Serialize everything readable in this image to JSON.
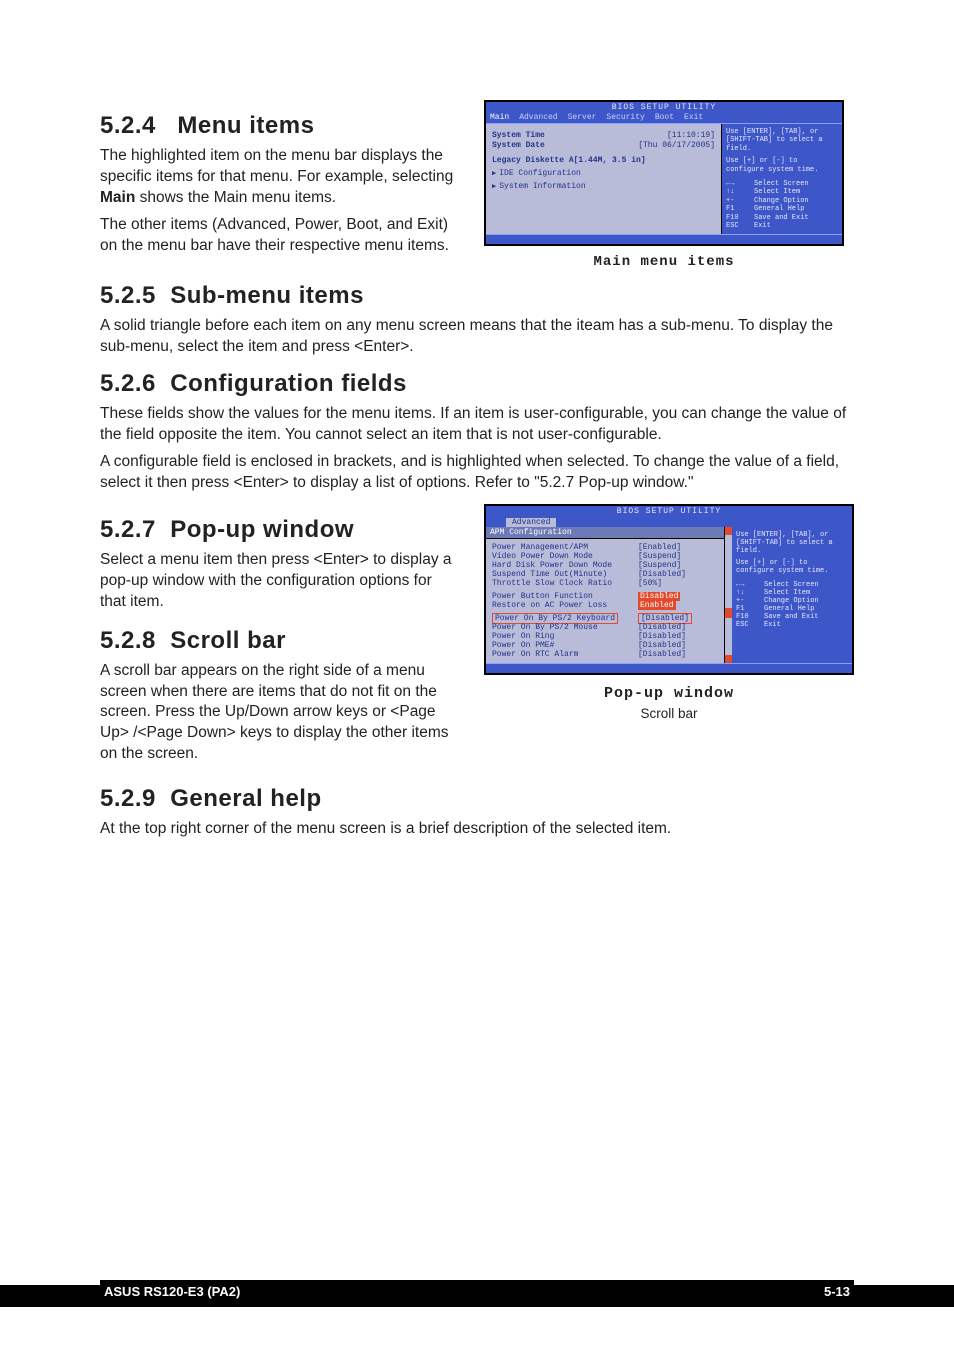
{
  "sections": {
    "s524": {
      "num": "5.2.4",
      "title": "Menu items",
      "p1": "The highlighted item on the menu bar  displays the specific items for that menu. For example, selecting ",
      "p1b": "Main",
      "p1c": " shows the Main menu items.",
      "p2": "The other items (Advanced, Power, Boot, and Exit) on the menu bar have their respective menu items."
    },
    "s525": {
      "num": "5.2.5",
      "title": "Sub-menu items",
      "p1": "A solid triangle before each item on any menu screen means that the iteam has a sub-menu. To display the sub-menu, select the item and press <Enter>."
    },
    "s526": {
      "num": "5.2.6",
      "title": "Configuration fields",
      "p1": "These fields show the values for the menu items. If an item is user-configurable, you can change the value of the field opposite the item. You cannot select an item that is not user-configurable.",
      "p2": "A configurable field is enclosed in brackets, and is highlighted when selected. To change the value of a field, select it then press <Enter> to display a list of options. Refer to \"5.2.7 Pop-up window.\""
    },
    "s527": {
      "num": "5.2.7",
      "title": "Pop-up window",
      "p1": "Select a menu item then press <Enter> to display a pop-up window with the configuration options for that item."
    },
    "s528": {
      "num": "5.2.8",
      "title": "Scroll bar",
      "p1": "A scroll bar appears on the right side of a menu screen when there are items that do not fit on the screen. Press the Up/Down arrow keys or <Page Up> /<Page Down> keys to display the other items on the screen."
    },
    "s529": {
      "num": "5.2.9",
      "title": "General help",
      "p1": "At the top right corner of the menu screen is a brief description of the selected item."
    }
  },
  "bios1": {
    "title": "BIOS SETUP UTILITY",
    "tabs": [
      "Main",
      "Advanced",
      "Server",
      "Security",
      "Boot",
      "Exit"
    ],
    "rows": {
      "time_lbl": "System Time",
      "time_val": "[11:10:19]",
      "date_lbl": "System Date",
      "date_val": "[Thu 06/17/2005]",
      "diskette": "Legacy Diskette A[1.44M, 3.5 in]",
      "ide": "IDE Configuration",
      "sysinfo": "System Information"
    },
    "help": {
      "l1": "Use [ENTER], [TAB], or [SHIFT-TAB] to select a field.",
      "l2": "Use [+] or [-] to configure system time."
    },
    "keys": [
      {
        "k": "←→",
        "d": "Select Screen"
      },
      {
        "k": "↑↓",
        "d": "Select Item"
      },
      {
        "k": "+-",
        "d": "Change Option"
      },
      {
        "k": "F1",
        "d": "General Help"
      },
      {
        "k": "F10",
        "d": "Save and Exit"
      },
      {
        "k": "ESC",
        "d": "Exit"
      }
    ],
    "caption": "Main menu items"
  },
  "bios2": {
    "title": "BIOS SETUP UTILITY",
    "tab": "Advanced",
    "header": "APM Configuration",
    "items": [
      {
        "lbl": "Power Management/APM",
        "val": "[Enabled]"
      },
      {
        "lbl": "Video Power Down Mode",
        "val": "[Suspend]"
      },
      {
        "lbl": "Hard Disk Power Down Mode",
        "val": "[Suspend]"
      },
      {
        "lbl": "Suspend Time Out(Minute)",
        "val": "[Disabled]"
      },
      {
        "lbl": "Throttle Slow Clock Ratio",
        "val": "[50%]"
      },
      {
        "lbl": "Power Button Function",
        "val": "Disabled",
        "hl": true
      },
      {
        "lbl": "Restore on AC Power Loss",
        "val": "Enabled",
        "hl": true
      },
      {
        "lbl": "Power On By PS/2 Keyboard",
        "val": "[Disabled]",
        "box": true
      },
      {
        "lbl": "Power On By PS/2 Mouse",
        "val": "[Disabled]"
      },
      {
        "lbl": "Power On Ring",
        "val": "[Disabled]"
      },
      {
        "lbl": "Power On PME#",
        "val": "[Disabled]"
      },
      {
        "lbl": "Power On RTC Alarm",
        "val": "[Disabled]"
      }
    ],
    "help": {
      "l1": "Use [ENTER], [TAB], or [SHIFT-TAB] to select a field.",
      "l2": "Use [+] or [-] to configure system time."
    },
    "keys": [
      {
        "k": "←→",
        "d": "Select Screen"
      },
      {
        "k": "↑↓",
        "d": "Select Item"
      },
      {
        "k": "+-",
        "d": "Change Option"
      },
      {
        "k": "F1",
        "d": "General Help"
      },
      {
        "k": "F10",
        "d": "Save and Exit"
      },
      {
        "k": "ESC",
        "d": "Exit"
      }
    ],
    "caption_popup": "Pop-up window",
    "caption_scroll": "Scroll bar"
  },
  "footer": {
    "left": "ASUS RS120-E3 (PA2)",
    "right": "5-13"
  }
}
